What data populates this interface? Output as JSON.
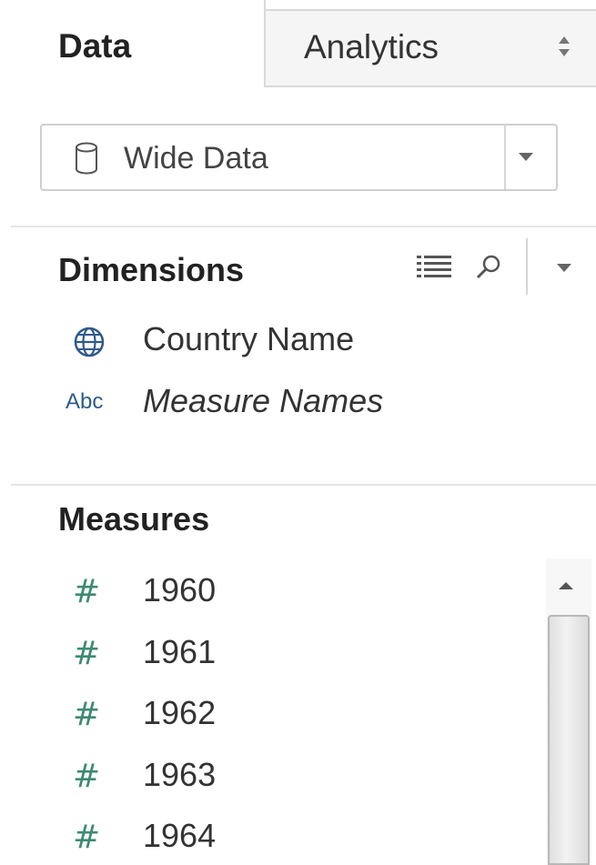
{
  "tabs": {
    "data_label": "Data",
    "analytics_label": "Analytics"
  },
  "datasource": {
    "name": "Wide Data",
    "icon": "database-icon"
  },
  "dimensions": {
    "title": "Dimensions",
    "items": [
      {
        "label": "Country Name",
        "icon": "globe-icon"
      },
      {
        "label": "Measure Names",
        "icon": "abc-text-icon",
        "icon_text": "Abc"
      }
    ]
  },
  "measures": {
    "title": "Measures",
    "items": [
      {
        "label": "1960",
        "icon": "hash-icon",
        "icon_text": "#"
      },
      {
        "label": "1961",
        "icon": "hash-icon",
        "icon_text": "#"
      },
      {
        "label": "1962",
        "icon": "hash-icon",
        "icon_text": "#"
      },
      {
        "label": "1963",
        "icon": "hash-icon",
        "icon_text": "#"
      },
      {
        "label": "1964",
        "icon": "hash-icon",
        "icon_text": "#"
      }
    ]
  },
  "colors": {
    "measure_green": "#3d8a72",
    "dimension_blue": "#2f5a8a"
  }
}
